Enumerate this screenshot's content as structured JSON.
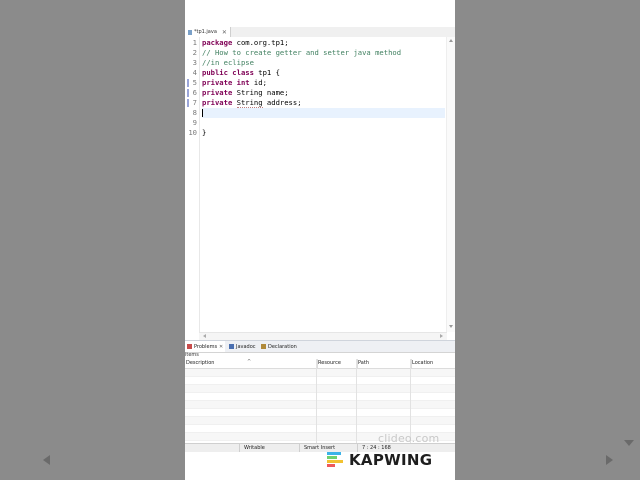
{
  "editor": {
    "tab_label": "*tp1.java",
    "tab_close": "✕",
    "lines": [
      {
        "num": "1",
        "parts": [
          {
            "t": "kw",
            "s": "package"
          },
          {
            "t": "tx",
            "s": " com.org.tp1;"
          }
        ]
      },
      {
        "num": "2",
        "parts": [
          {
            "t": "cm",
            "s": "// How to create getter and setter java method"
          }
        ]
      },
      {
        "num": "3",
        "parts": [
          {
            "t": "cm",
            "s": "//in eclipse"
          }
        ]
      },
      {
        "num": "4",
        "parts": [
          {
            "t": "kw",
            "s": "public class"
          },
          {
            "t": "tx",
            "s": " tp1 {"
          }
        ]
      },
      {
        "num": "5",
        "parts": [
          {
            "t": "kw",
            "s": "private int"
          },
          {
            "t": "tx",
            "s": " id;"
          }
        ]
      },
      {
        "num": "6",
        "parts": [
          {
            "t": "kw",
            "s": "private"
          },
          {
            "t": "tx",
            "s": " String name;"
          }
        ]
      },
      {
        "num": "7",
        "parts": [
          {
            "t": "kw",
            "s": "private"
          },
          {
            "t": "tx",
            "s": " "
          },
          {
            "t": "sq",
            "s": "String"
          },
          {
            "t": "tx",
            "s": " address;"
          }
        ]
      },
      {
        "num": "8",
        "parts": []
      },
      {
        "num": "9",
        "parts": []
      },
      {
        "num": "10",
        "parts": [
          {
            "t": "tx",
            "s": "}"
          }
        ]
      }
    ]
  },
  "panel": {
    "tabs": [
      {
        "label": "Problems",
        "icon": "problems-icon",
        "close": "✕",
        "color": "#c94c4c"
      },
      {
        "label": "Javadoc",
        "icon": "javadoc-icon",
        "color": "#4a6fb0"
      },
      {
        "label": "Declaration",
        "icon": "declaration-icon",
        "color": "#b08a3a"
      }
    ],
    "items_label": "items",
    "columns": [
      "Description",
      "Resource",
      "Path",
      "Location"
    ],
    "sort_indicator": "^"
  },
  "status": {
    "writable": "Writable",
    "insert_mode": "Smart Insert",
    "position": "7 : 24 : 168"
  },
  "watermark": {
    "clideo": "clideo.com",
    "kapwing": "KAPWING"
  },
  "colors": {
    "keyword": "#7f0055",
    "comment": "#3f7f5f",
    "kapwing_bars": [
      "#3bb3e8",
      "#6fd16f",
      "#f2c230",
      "#ee5a5a"
    ]
  }
}
